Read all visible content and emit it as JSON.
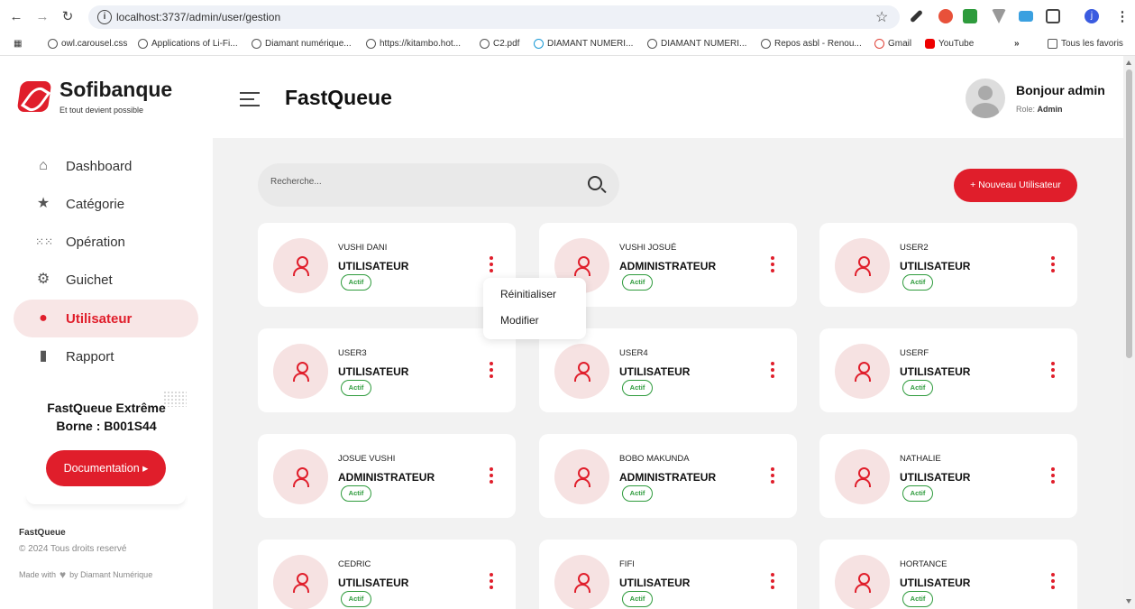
{
  "browser": {
    "url": "localhost:3737/admin/user/gestion",
    "bookmarks": [
      "owl.carousel.css",
      "Applications of Li-Fi...",
      "Diamant numérique...",
      "https://kitambo.hot...",
      "C2.pdf",
      "DIAMANT NUMERI...",
      "DIAMANT NUMERI...",
      "Repos asbl - Renou...",
      "Gmail",
      "YouTube"
    ],
    "overflow_label": "»",
    "favorites_label": "Tous les favoris",
    "profile_initial": "j"
  },
  "sidebar": {
    "brand_name": "Sofibanque",
    "tagline": "Et tout devient possible",
    "menu": [
      {
        "label": "Dashboard",
        "icon": "home-icon"
      },
      {
        "label": "Catégorie",
        "icon": "star-icon"
      },
      {
        "label": "Opération",
        "icon": "grid-icon"
      },
      {
        "label": "Guichet",
        "icon": "gear-icon"
      },
      {
        "label": "Utilisateur",
        "icon": "user-icon",
        "active": true
      },
      {
        "label": "Rapport",
        "icon": "file-icon"
      }
    ],
    "promo_line1": "FastQueue Extrême",
    "promo_line2": "Borne : B001S44",
    "doc_button": "Documentation ▸",
    "footer_brand": "FastQueue",
    "footer_copy": "© 2024 Tous droits reservé",
    "footer_made_with": "Made with",
    "footer_by": "by Diamant Numérique"
  },
  "header": {
    "title": "FastQueue",
    "greeting": "Bonjour admin",
    "role_label": "Role:",
    "role_value": "Admin"
  },
  "toolbar": {
    "search_placeholder": "Recherche...",
    "new_user_button": "+ Nouveau Utilisateur"
  },
  "users": [
    {
      "name": "VUSHI DANI",
      "role": "UTILISATEUR",
      "status": "Actif"
    },
    {
      "name": "VUSHI JOSUÉ",
      "role": "ADMINISTRATEUR",
      "status": "Actif"
    },
    {
      "name": "USER2",
      "role": "UTILISATEUR",
      "status": "Actif"
    },
    {
      "name": "USER3",
      "role": "UTILISATEUR",
      "status": "Actif"
    },
    {
      "name": "USER4",
      "role": "UTILISATEUR",
      "status": "Actif"
    },
    {
      "name": "USERF",
      "role": "UTILISATEUR",
      "status": "Actif"
    },
    {
      "name": "JOSUE VUSHI",
      "role": "ADMINISTRATEUR",
      "status": "Actif"
    },
    {
      "name": "BOBO MAKUNDA",
      "role": "ADMINISTRATEUR",
      "status": "Actif"
    },
    {
      "name": "NATHALIE",
      "role": "UTILISATEUR",
      "status": "Actif"
    },
    {
      "name": "CEDRIC",
      "role": "UTILISATEUR",
      "status": "Actif"
    },
    {
      "name": "FIFI",
      "role": "UTILISATEUR",
      "status": "Actif"
    },
    {
      "name": "HORTANCE",
      "role": "UTILISATEUR",
      "status": "Actif"
    }
  ],
  "dropdown": {
    "items": [
      "Réinitialiser",
      "Modifier"
    ]
  },
  "colors": {
    "accent": "#e01e2b",
    "active_bg": "#f8e6e6",
    "status_green": "#2e9b3c"
  }
}
